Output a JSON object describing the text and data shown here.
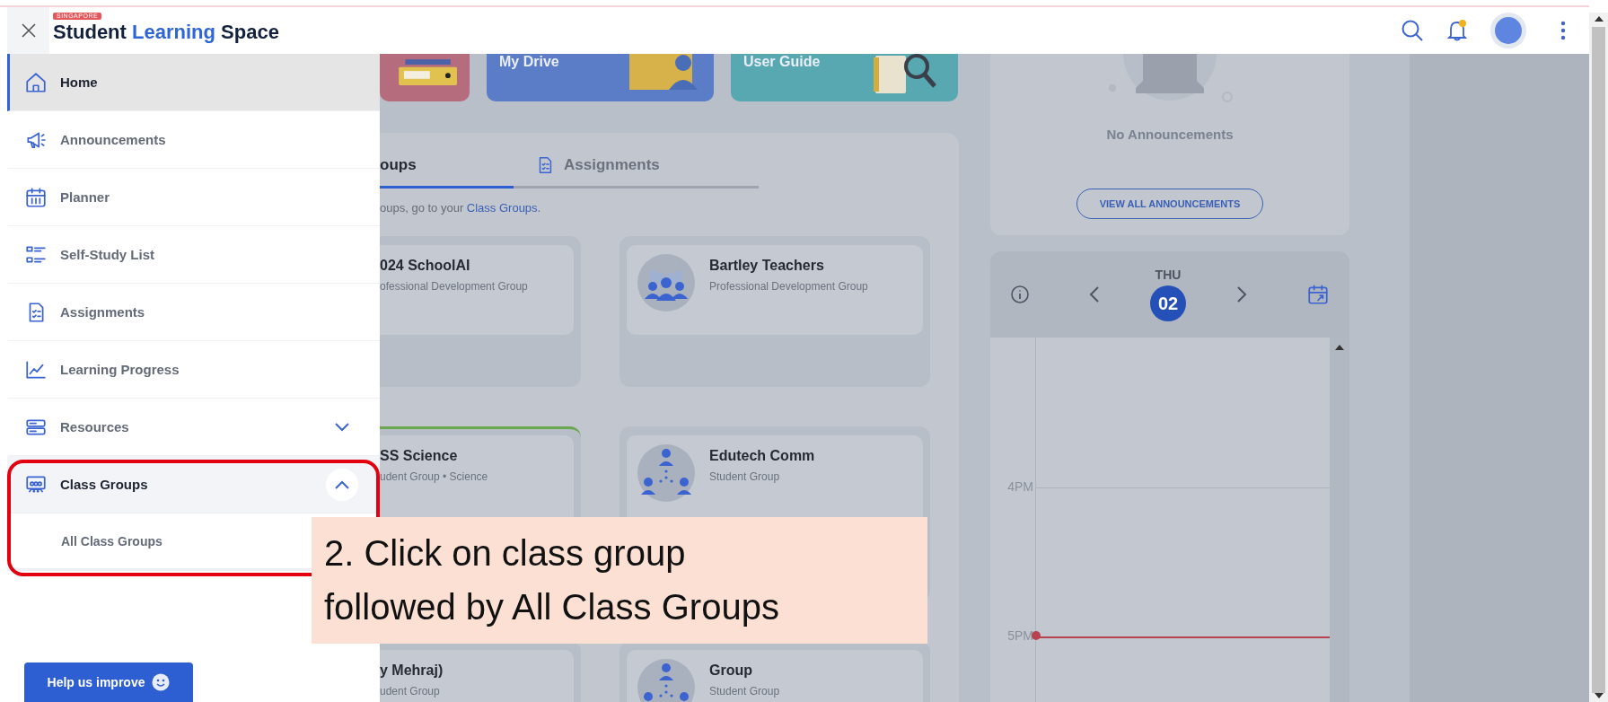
{
  "header": {
    "logo": {
      "tag": "SINGAPORE",
      "words": [
        {
          "text": "Student",
          "accent": false
        },
        {
          "text": "Learning",
          "accent": true
        },
        {
          "text": "Space",
          "accent": false
        }
      ]
    },
    "notifications": {
      "unread": true
    }
  },
  "sidebar": {
    "items": [
      {
        "label": "Home",
        "selected": true
      },
      {
        "label": "Announcements",
        "selected": false
      },
      {
        "label": "Planner",
        "selected": false
      },
      {
        "label": "Self-Study List",
        "selected": false
      },
      {
        "label": "Assignments",
        "selected": false
      },
      {
        "label": "Learning Progress",
        "selected": false
      },
      {
        "label": "Resources",
        "selected": false,
        "expanded": false
      },
      {
        "label": "Class Groups",
        "selected": false,
        "expanded": true,
        "children": [
          {
            "label": "All Class Groups",
            "selected": false
          }
        ]
      }
    ],
    "help_button": {
      "label": "Help us improve"
    }
  },
  "shortcuts": [
    {
      "kind": "folder",
      "color": "#b56d7d"
    },
    {
      "kind": "drive",
      "label": "My Drive",
      "color": "#5b7cc6"
    },
    {
      "kind": "guide",
      "label": "User Guide",
      "color": "#57a8b0"
    }
  ],
  "groups_panel": {
    "tabs": [
      {
        "label": "oups",
        "selected": true
      },
      {
        "label": "Assignments",
        "selected": false
      }
    ],
    "hint": {
      "text": "oups, go to your ",
      "link": "Class Groups",
      "end": "."
    },
    "groups": [
      {
        "title": [
          "024 SchoolAI"
        ],
        "subtitle": "ofessional Development Group",
        "kind": "cut"
      },
      {
        "title": [
          "Bartley Teachers"
        ],
        "subtitle": "Professional Development Group",
        "kind": "staff"
      },
      {
        "title": [
          "SS Science"
        ],
        "subtitle": "udent Group • Science",
        "color": "#6aa84f",
        "kind": "cut"
      },
      {
        "title": [
          "Edutech Comm"
        ],
        "subtitle": "Student Group",
        "kind": "network"
      },
      {
        "title": [
          "y Mehraj)"
        ],
        "subtitle": "udent Group",
        "kind": "cut"
      },
      {
        "title": [
          "Group"
        ],
        "subtitle": "Student Group",
        "kind": "network"
      }
    ]
  },
  "announcements": {
    "empty_text": "No Announcements",
    "button": "VIEW ALL ANNOUNCEMENTS"
  },
  "calendar": {
    "day": "THU",
    "date": "02",
    "hours": [
      {
        "label": "4PM",
        "now": false
      },
      {
        "label": "5PM",
        "now": true
      }
    ]
  },
  "callout": {
    "lines": [
      "2. Click on class group",
      "followed by All Class Groups"
    ]
  }
}
